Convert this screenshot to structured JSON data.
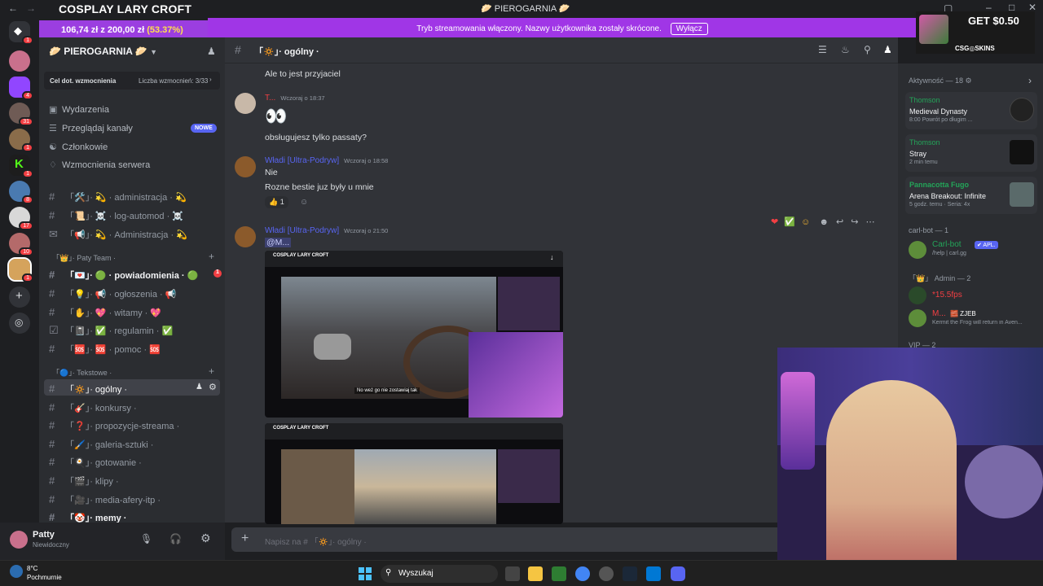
{
  "stream": {
    "title": "COSPLAY LARY CROFT",
    "goal_amount": "106,74 zł z 200,00 zł",
    "goal_percent": "(53.37%)",
    "ad_text": "GET $0.50",
    "ad_brand": "CSG◎SKINS"
  },
  "window": {
    "title": "🥟 PIEROGARNIA 🥟"
  },
  "banner": {
    "text": "Tryb streamowania włączony. Nazwy użytkownika zostały skrócone.",
    "button": "Wyłącz"
  },
  "server": {
    "name": "🥟 PIEROGARNIA 🥟",
    "boost_left": "Cel dot. wzmocnienia",
    "boost_right": "Liczba wzmocnień: 3/33",
    "menu": [
      {
        "label": "Wydarzenia",
        "icon": "calendar-icon"
      },
      {
        "label": "Przeglądaj kanały",
        "icon": "browse-icon",
        "badge": "NOWE"
      },
      {
        "label": "Członkowie",
        "icon": "members-icon"
      },
      {
        "label": "Wzmocnienia serwera",
        "icon": "boost-icon"
      }
    ],
    "channels_top": [
      {
        "label": "「🛠️」· 💫 · administracja · 💫"
      },
      {
        "label": "「📜」· ☠️ · log-automod · ☠️"
      },
      {
        "label": "「📢」· 💫 · Administracja · 💫"
      }
    ],
    "category_patty": "「👑」· Paty Team ·",
    "channels_patty": [
      {
        "label": "「💌」· 🟢 · powiadomienia · 🟢",
        "badge": "1"
      },
      {
        "label": "「💡」· 📢 · ogłoszenia · 📢"
      },
      {
        "label": "「✋」· 💖 · witamy · 💖"
      },
      {
        "label": "「📓」· ✅ · regulamin · ✅"
      },
      {
        "label": "「🆘」· 🆘 · pomoc · 🆘"
      }
    ],
    "category_text": "「🔵」· Tekstowe ·",
    "channels_text": [
      {
        "label": "「🔅」· ogólny ·"
      },
      {
        "label": "「🎸」· konkursy ·"
      },
      {
        "label": "「❓」· propozycje-streama ·"
      },
      {
        "label": "「🖌️」· galeria-sztuki ·"
      },
      {
        "label": "「🍳」· gotowanie ·"
      },
      {
        "label": "「🎬」· klipy ·"
      },
      {
        "label": "「🎥」· media-afery-itp ·"
      },
      {
        "label": "「🤡」· memy ·"
      }
    ]
  },
  "user": {
    "name": "Patty",
    "status": "Niewidoczny"
  },
  "chat": {
    "channel": "「🔅」· ogólny ·",
    "messages": [
      {
        "text": "Ale to jest przyjaciel"
      },
      {
        "author": "T...",
        "time": "Wczoraj o 18:37",
        "line1": "👀",
        "line2": "obsługujesz tylko passaty?"
      },
      {
        "author": "Władi [Ultra-Podryw]",
        "time": "Wczoraj o 18:58",
        "line1": "Nie",
        "line2": "Rozne bestie juz były u mnie",
        "reaction": "👍 1"
      },
      {
        "author": "Władi [Ultra-Podryw]",
        "time": "Wczoraj o 21:50",
        "line1": "@M..."
      }
    ],
    "screenshot_title": "COSPLAY LARY CROFT",
    "screenshot_caption": "No weż go nie zostawiaj tak",
    "composer_placeholder": "Napisz na # 「🔅」· ogólny ·"
  },
  "members": {
    "activity_header": "Aktywność — 18",
    "activities": [
      {
        "user": "Thomson",
        "game": "Medieval Dynasty",
        "detail": "8:00  Powrót po długim ..."
      },
      {
        "user": "Thomson",
        "game": "Stray",
        "detail": "2 min temu"
      },
      {
        "user": "Pannacotta Fugo",
        "game": "Arena Breakout: Infinite",
        "detail": "5 godz. temu · Seria: 4x"
      }
    ],
    "carl_header": "carl-bot — 1",
    "carl_name": "Carl-bot",
    "carl_tag": "✔ APL.",
    "carl_status": "/help | carl.gg",
    "admin_header": "「👑」 Admin — 2",
    "admin1": "*15.5fps",
    "admin2": "M...",
    "admin2_tag": "🧱 ZJEB",
    "admin2_status": "Kermit the Frog will return in Aven...",
    "vip_header": "VIP — 2"
  },
  "taskbar": {
    "weather_temp": "8°C",
    "weather_desc": "Pochmurnie",
    "search": "Wyszukaj"
  },
  "colors": {
    "accent": "#5865f2",
    "banner": "#a036e6",
    "mention": "#f23f43"
  }
}
